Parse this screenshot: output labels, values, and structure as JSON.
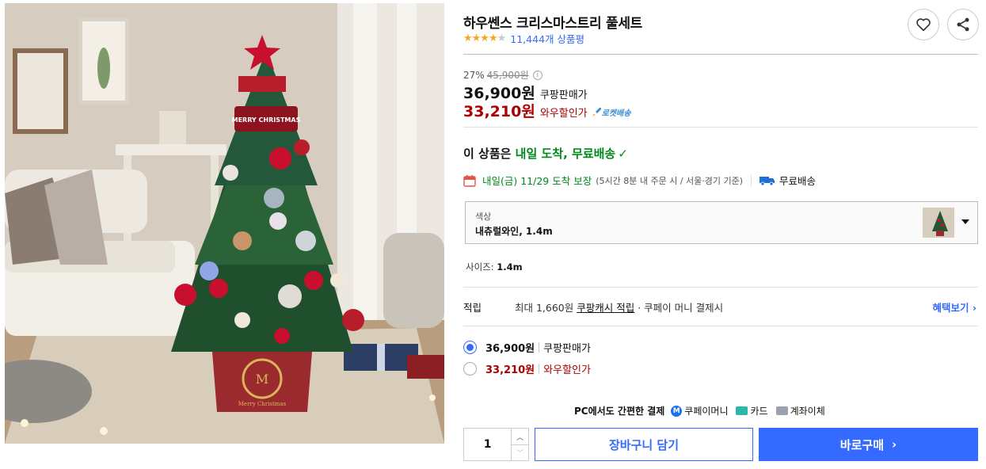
{
  "product": {
    "title": "하우쎈스 크리스마스트리 풀세트",
    "rating_stars": 4.5,
    "review_count": "11,444개 상품평",
    "image_alt": "Christmas tree full set in living room",
    "tree_box_text": "Merry Christmas",
    "tree_sign_text": "MERRY CHRISTMAS"
  },
  "pricing": {
    "discount_rate": "27%",
    "original_price": "45,900원",
    "info_icon": "info-icon",
    "sale_price": "36,900원",
    "sale_label": "쿠팡판매가",
    "wow_price": "33,210원",
    "wow_label": "와우할인가",
    "rocket_badge": "로켓배송"
  },
  "delivery": {
    "headline_prefix": "이 상품은 ",
    "headline_highlight": "내일 도착, 무료배송",
    "date_text": "내일(금) 11/29 도착 보장",
    "date_sub": "(5시간 8분  내 주문 시 / 서울·경기 기준)",
    "free_shipping": "무료배송"
  },
  "option": {
    "label": "색상",
    "selected": "내츄럴와인, 1.4m"
  },
  "size": {
    "label": "사이즈: ",
    "value": "1.4m"
  },
  "reward": {
    "head": "적립",
    "desc_prefix": "최대 1,660원 ",
    "desc_link": "쿠팡캐시 적립",
    "desc_suffix": " · 쿠페이 머니 결제시",
    "more": "혜택보기"
  },
  "price_options": [
    {
      "amount": "36,900원",
      "label": "쿠팡판매가",
      "selected": true
    },
    {
      "amount": "33,210원",
      "label": "와우할인가",
      "selected": false
    }
  ],
  "payment": {
    "headline": "PC에서도 간편한 결제",
    "coupay": "쿠페이머니",
    "card": "카드",
    "bank": "계좌이체"
  },
  "purchase": {
    "quantity": "1",
    "cart_button": "장바구니 담기",
    "buy_button": "바로구매"
  },
  "colors": {
    "accent": "#346aff",
    "wow_red": "#ae0000",
    "green": "#00891a",
    "star": "#f5a623"
  }
}
